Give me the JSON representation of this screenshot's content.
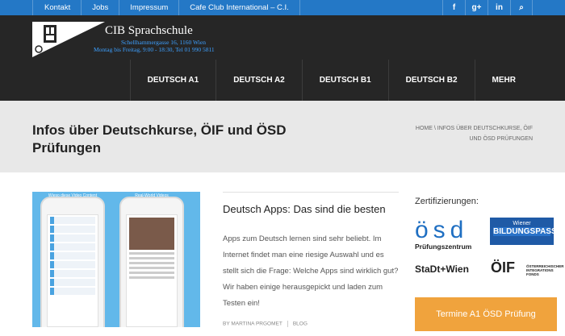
{
  "topbar": {
    "links": [
      "Kontakt",
      "Jobs",
      "Impressum",
      "Cafe Club International – C.I."
    ],
    "icons": [
      "facebook-icon",
      "google-plus-icon",
      "linkedin-icon",
      "search-icon"
    ],
    "icon_glyphs": [
      "f",
      "g+",
      "in",
      "⌕"
    ],
    "color": "#2478c6"
  },
  "header": {
    "brand_name": "CIB Sprachschule",
    "address": "Schellhammergasse 16, 1160 Wien",
    "hours": "Montag bis Freitag, 9:00 - 18:30, Tel 01 990 5811",
    "nav": [
      "DEUTSCH A1",
      "DEUTSCH A2",
      "DEUTSCH B1",
      "DEUTSCH B2",
      "MEHR"
    ]
  },
  "page": {
    "title": "Infos über Deutschkurse, ÖIF und ÖSD Prüfungen",
    "breadcrumb": "HOME \\ INFOS ÜBER DEUTSCHKURSE, ÖIF UND ÖSD PRÜFUNGEN"
  },
  "post": {
    "thumb_captions": [
      "Wieso diese Video Content",
      "Real-World Videos"
    ],
    "title": "Deutsch Apps: Das sind die besten",
    "excerpt": "Apps zum Deutsch lernen sind sehr beliebt. Im Internet findet man eine riesige Auswahl und es stellt sich die Frage: Welche Apps sind wirklich gut? Wir haben einige herausgepickt und laden zum Testen ein!",
    "author": "BY MARTINA PRGOMET",
    "category": "BLOG"
  },
  "sidebar": {
    "title": "Zertifizierungen:",
    "osd_logo": "ösd",
    "osd_sub": "Prüfungszentrum",
    "wbp_line1": "Wiener",
    "wbp_line2": "BILDUNGSPASS",
    "stadt_wien": "StaDt+Wien",
    "oif_big": "ÖIF",
    "oif_small": "ÖSTERREICHISCHER INTEGRATIONS FONDS",
    "cta_label": "Termine A1 ÖSD Prüfung",
    "cta_color": "#f0a33d"
  }
}
